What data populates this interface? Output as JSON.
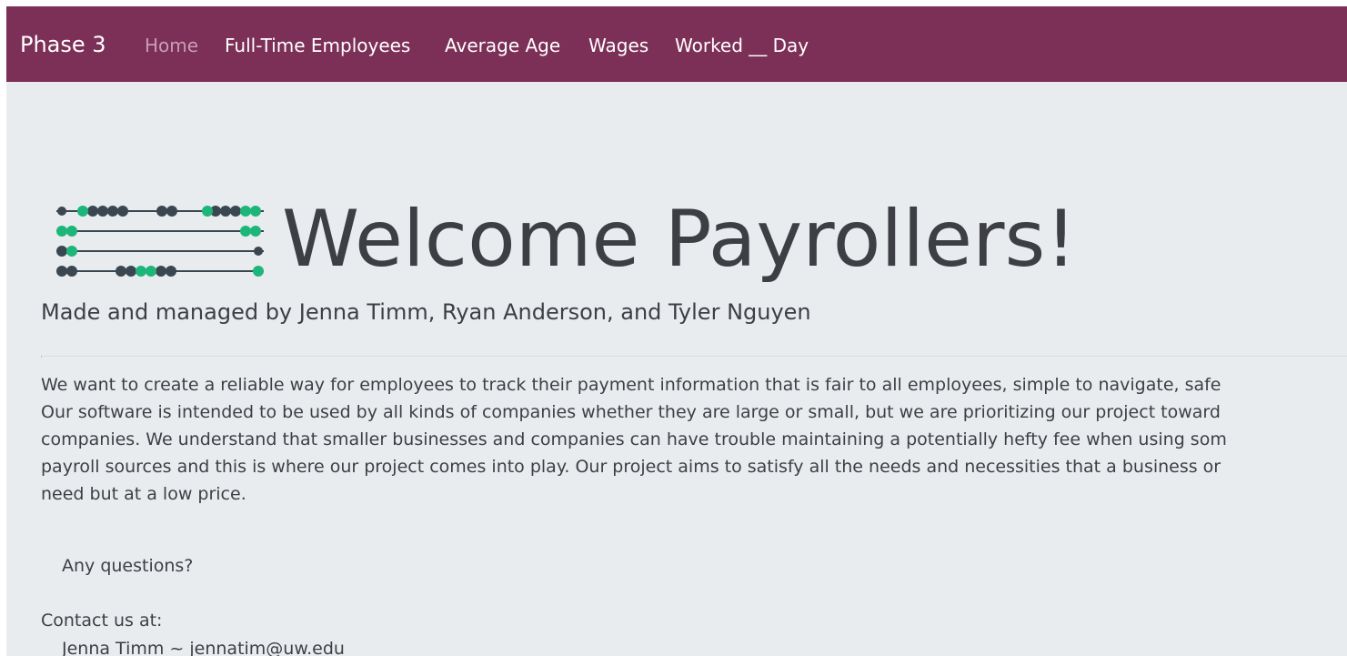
{
  "navbar": {
    "brand": "Phase 3",
    "items": [
      {
        "label": "Home",
        "active": true
      },
      {
        "label": "Full-Time Employees",
        "active": false
      },
      {
        "label": "Average Age",
        "active": false
      },
      {
        "label": "Wages",
        "active": false
      },
      {
        "label": "Worked __ Day",
        "active": false
      }
    ]
  },
  "colors": {
    "navbar_bg": "#7d3057",
    "page_bg": "#e9ecef",
    "active_link": "#c89db5",
    "abacus_bead_dark": "#3a4650",
    "abacus_bead_accent": "#1db67a"
  },
  "hero": {
    "logo_icon": "abacus-icon",
    "title": "Welcome Payrollers!",
    "lead": "Made and managed by Jenna Timm, Ryan Anderson, and Tyler Nguyen"
  },
  "about": {
    "lines": [
      "We want to create a reliable way for employees to track their payment information that is fair to all employees, simple to navigate, safe",
      "Our software is intended to be used by all kinds of companies whether they are large or small, but we are prioritizing our project toward",
      "companies. We understand that smaller businesses and companies can have trouble maintaining a potentially hefty fee when using som",
      "payroll sources and this is where our project comes into play. Our project aims to satisfy all the needs and necessities that a business or",
      "need but at a low price."
    ]
  },
  "questions": "Any questions?",
  "contact": {
    "heading": "Contact us at:",
    "entries": [
      "Jenna Timm ~ jennatim@uw.edu"
    ]
  }
}
